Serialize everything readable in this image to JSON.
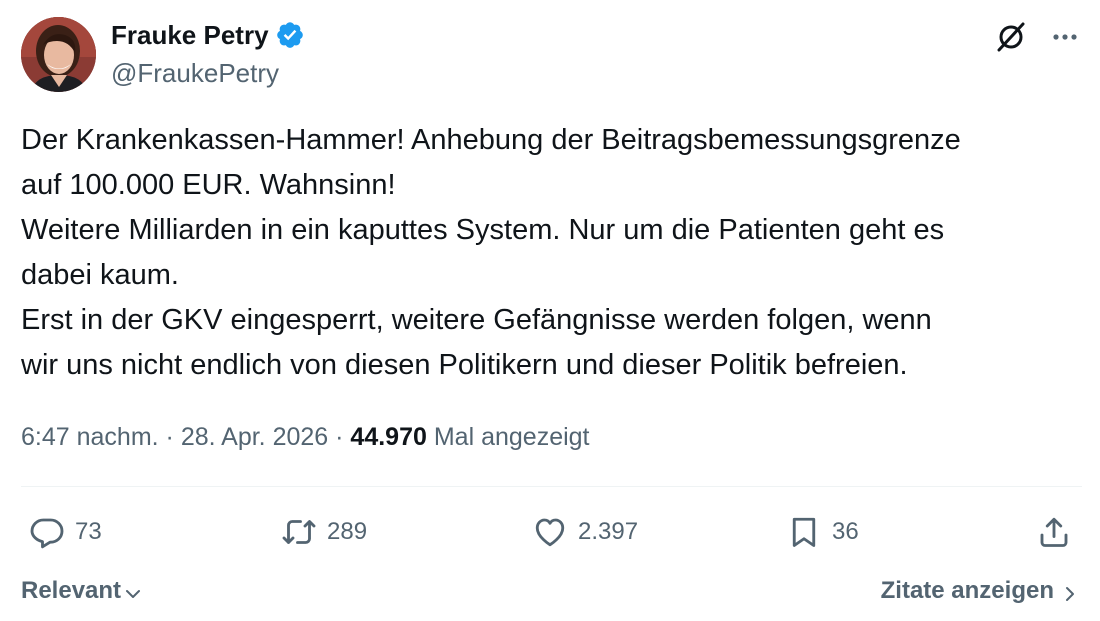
{
  "author": {
    "display_name": "Frauke Petry",
    "handle": "@FraukePetry",
    "verified": true
  },
  "header_actions": {
    "icons": [
      "grok-icon",
      "more-icon"
    ]
  },
  "tweet": {
    "lines": [
      "Der Krankenkassen-Hammer! Anhebung der Beitragsbemessungsgrenze",
      "auf 100.000 EUR. Wahnsinn!",
      "Weitere Milliarden in ein kaputtes System. Nur um die Patienten geht es",
      "dabei kaum.",
      "Erst in der GKV eingesperrt, weitere Gefängnisse werden folgen, wenn",
      "wir uns nicht endlich von diesen Politikern und dieser Politik befreien."
    ]
  },
  "meta": {
    "time": "6:47 nachm.",
    "separator": "·",
    "date": "28. Apr. 2026",
    "views_count": "44.970",
    "views_label": "Mal angezeigt"
  },
  "actions": {
    "replies": "73",
    "retweets": "289",
    "likes": "2.397",
    "bookmarks": "36"
  },
  "footer": {
    "sort_label": "Relevant",
    "quotes_label": "Zitate anzeigen"
  },
  "colors": {
    "text": "#0f1419",
    "secondary": "#536471",
    "verified_blue": "#1d9bf0",
    "divider": "#eff3f4"
  }
}
